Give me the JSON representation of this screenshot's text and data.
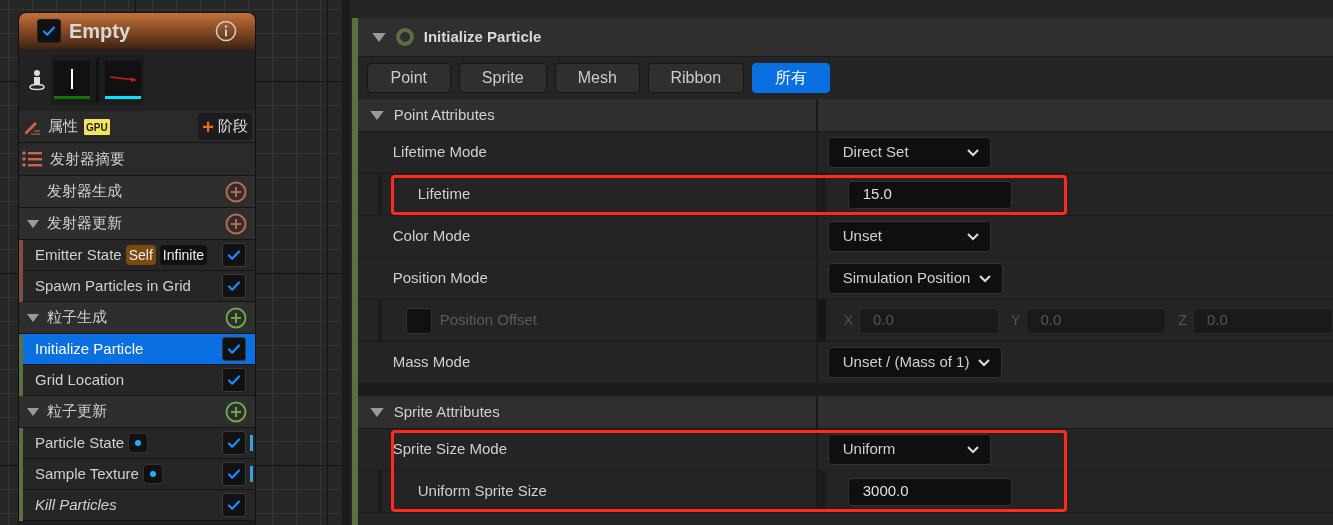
{
  "node": {
    "title": "Empty",
    "enabled": true,
    "properties_row": {
      "label": "属性",
      "badge": "GPU",
      "button": "阶段",
      "button_icon": "+"
    },
    "items": [
      {
        "kind": "summary",
        "label": "发射器摘要"
      },
      {
        "kind": "stage",
        "label": "发射器生成",
        "expanded": false,
        "color": "#c0674a"
      },
      {
        "kind": "stage",
        "label": "发射器更新",
        "expanded": true,
        "color": "#c0674a"
      },
      {
        "kind": "module",
        "label": "Emitter State",
        "badges": [
          {
            "text": "Self",
            "kind": "scope"
          },
          {
            "text": "Infinite",
            "kind": "value"
          }
        ],
        "checked": true,
        "selected": false,
        "color": "#7a5040",
        "marker": false
      },
      {
        "kind": "module",
        "label": "Spawn Particles in Grid",
        "checked": true,
        "selected": false,
        "color": "#7a5040",
        "marker": false
      },
      {
        "kind": "stage",
        "label": "粒子生成",
        "expanded": true,
        "color": "#6aa84f"
      },
      {
        "kind": "module",
        "label": "Initialize Particle",
        "checked": true,
        "selected": true,
        "color": "#5a7040",
        "marker": false
      },
      {
        "kind": "module",
        "label": "Grid Location",
        "checked": true,
        "selected": false,
        "color": "#5a7040",
        "marker": false
      },
      {
        "kind": "stage",
        "label": "粒子更新",
        "expanded": true,
        "color": "#6aa84f"
      },
      {
        "kind": "module",
        "label": "Particle State",
        "badges": [
          {
            "kind": "dot"
          }
        ],
        "checked": true,
        "selected": false,
        "color": "#5a7040",
        "marker": true
      },
      {
        "kind": "module",
        "label": "Sample Texture",
        "badges": [
          {
            "kind": "dot"
          }
        ],
        "checked": true,
        "selected": false,
        "color": "#5a7040",
        "marker": true
      },
      {
        "kind": "module",
        "label": "Kill Particles",
        "checked": true,
        "selected": false,
        "color": "#5a7040",
        "marker": false,
        "italic": true
      }
    ]
  },
  "details": {
    "title": "Initialize Particle",
    "tabs": [
      {
        "label": "Point",
        "selected": false
      },
      {
        "label": "Sprite",
        "selected": false
      },
      {
        "label": "Mesh",
        "selected": false
      },
      {
        "label": "Ribbon",
        "selected": false
      },
      {
        "label": "所有",
        "selected": true
      }
    ],
    "sections": [
      {
        "title": "Point Attributes",
        "expanded": true,
        "groups": [
          {
            "highlighted": false,
            "rows": [
              {
                "kind": "dropdown",
                "label": "Lifetime Mode",
                "value": "Direct Set"
              }
            ]
          },
          {
            "highlighted": true,
            "rows": [
              {
                "kind": "number",
                "label": "Lifetime",
                "value": "15.0"
              }
            ]
          },
          {
            "highlighted": false,
            "rows": [
              {
                "kind": "dropdown",
                "label": "Color Mode",
                "value": "Unset"
              },
              {
                "kind": "dropdown",
                "label": "Position Mode",
                "value": "Simulation Position"
              },
              {
                "kind": "vector",
                "label": "Position Offset",
                "checked": false,
                "disabled": true,
                "components": [
                  {
                    "axis": "X",
                    "value": "0.0"
                  },
                  {
                    "axis": "Y",
                    "value": "0.0"
                  },
                  {
                    "axis": "Z",
                    "value": "0.0"
                  }
                ]
              },
              {
                "kind": "dropdown",
                "label": "Mass Mode",
                "value": "Unset / (Mass of 1)"
              }
            ]
          }
        ]
      },
      {
        "title": "Sprite Attributes",
        "expanded": true,
        "groups": [
          {
            "highlighted": true,
            "rows": [
              {
                "kind": "dropdown",
                "label": "Sprite Size Mode",
                "value": "Uniform"
              },
              {
                "kind": "number",
                "label": "Uniform Sprite Size",
                "value": "3000.0"
              }
            ]
          }
        ]
      }
    ]
  }
}
